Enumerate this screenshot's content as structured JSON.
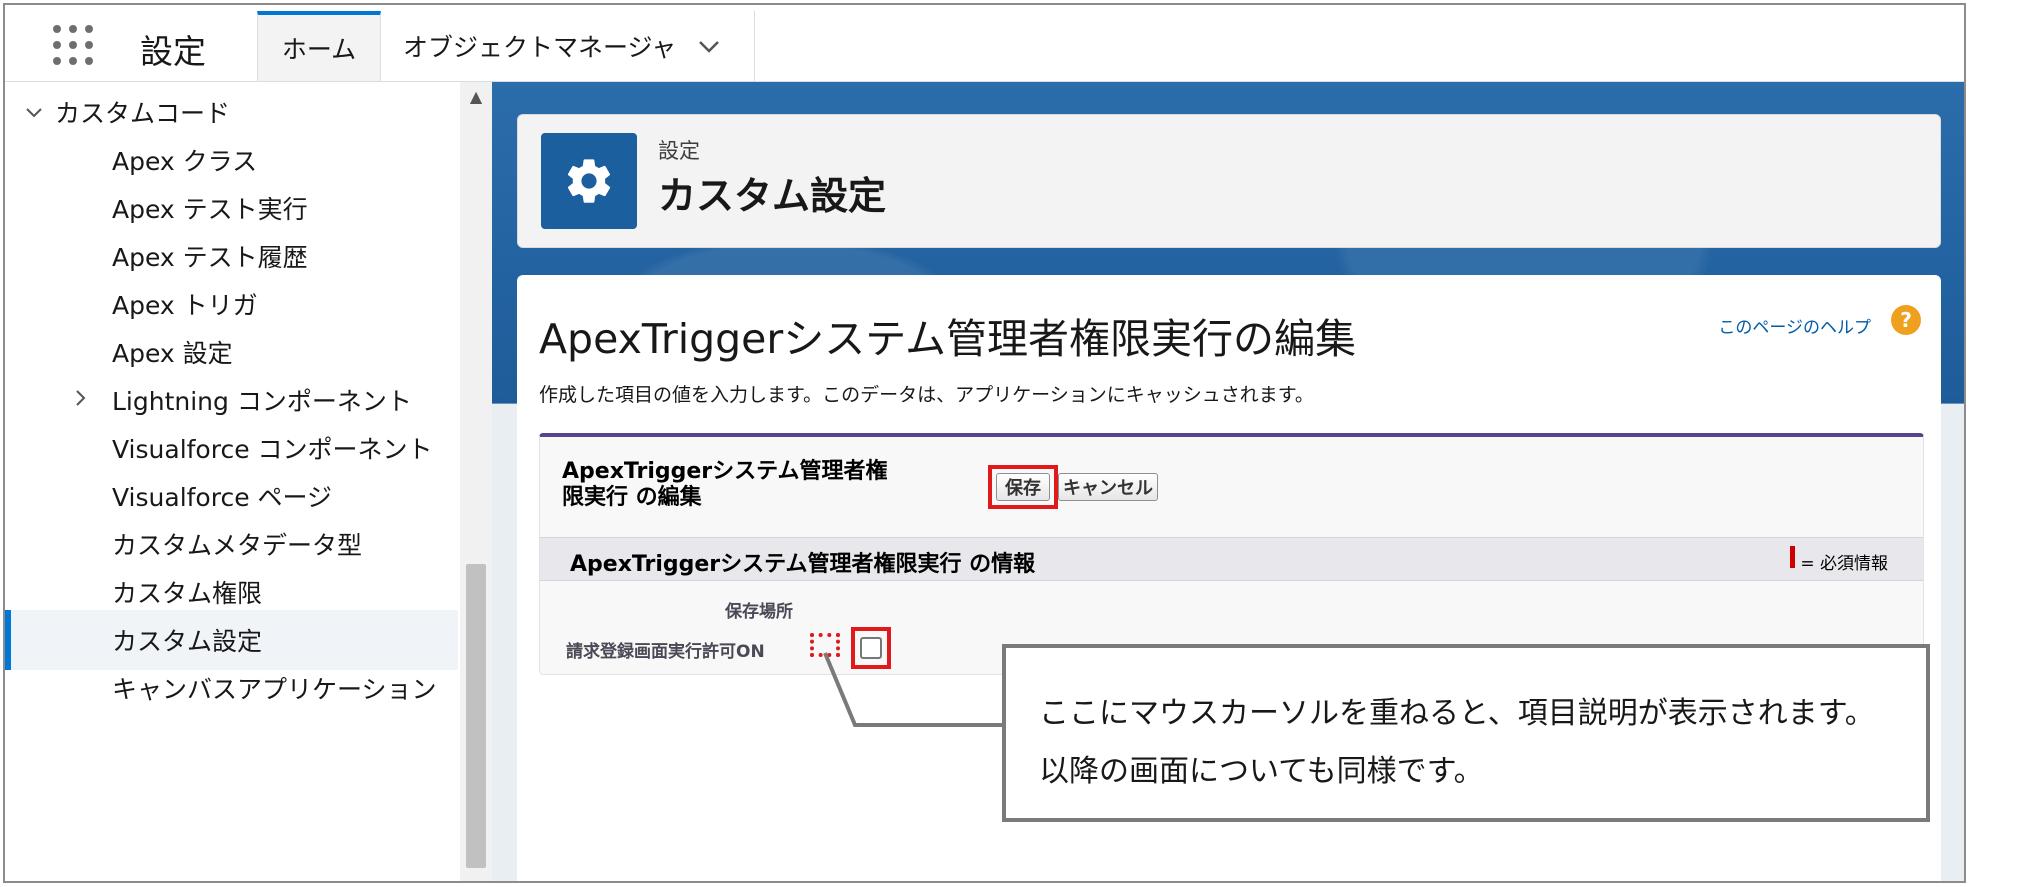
{
  "topnav": {
    "app_name": "設定",
    "tabs": [
      {
        "label": "ホーム"
      },
      {
        "label": "オブジェクトマネージャ"
      }
    ]
  },
  "sidebar": {
    "group_label": "カスタムコード",
    "items": [
      {
        "label": "Apex クラス"
      },
      {
        "label": "Apex テスト実行"
      },
      {
        "label": "Apex テスト履歴"
      },
      {
        "label": "Apex トリガ"
      },
      {
        "label": "Apex 設定"
      },
      {
        "label": "Lightning コンポーネント"
      },
      {
        "label": "Visualforce コンポーネント"
      },
      {
        "label": "Visualforce ページ"
      },
      {
        "label": "カスタムメタデータ型"
      },
      {
        "label": "カスタム権限"
      },
      {
        "label": "カスタム設定"
      },
      {
        "label": "キャンバスアプリケーション"
      }
    ]
  },
  "header": {
    "breadcrumb": "設定",
    "title": "カスタム設定"
  },
  "page": {
    "edit_title": "ApexTriggerシステム管理者権限実行の編集",
    "help_link": "このページのヘルプ",
    "help_icon": "?",
    "intro": "作成した項目の値を入力します。このデータは、アプリケーションにキャッシュされます。"
  },
  "block": {
    "title_line1": "ApexTriggerシステム管理者権",
    "title_line2": "限実行 の編集",
    "save_label": "保存",
    "cancel_label": "キャンセル",
    "section_title": "ApexTriggerシステム管理者権限実行 の情報",
    "required_text": "= 必須情報",
    "field1_label": "保存場所",
    "field2_label": "請求登録画面実行許可ON"
  },
  "callout": {
    "line1": "ここにマウスカーソルを重ねると、項目説明が表示されます。",
    "line2": "以降の画面についても同様です。"
  },
  "colors": {
    "accent": "#0176d3",
    "highlight": "#e01a1a",
    "brand_header": "#1b5f9e"
  }
}
